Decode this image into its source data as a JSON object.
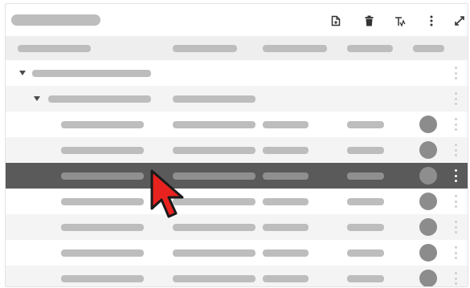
{
  "toolbar": {
    "title": "",
    "icons": [
      "add-document-icon",
      "delete-icon",
      "format-icon",
      "more-vert-icon",
      "expand-icon"
    ]
  },
  "table": {
    "columns": [
      "",
      "",
      "",
      "",
      ""
    ],
    "rows": [
      {
        "type": "group",
        "level": 0,
        "expanded": true
      },
      {
        "type": "group",
        "level": 1,
        "expanded": true
      },
      {
        "type": "item",
        "status": "circle"
      },
      {
        "type": "item",
        "status": "circle"
      },
      {
        "type": "item",
        "status": "circle",
        "selected": true
      },
      {
        "type": "item",
        "status": "circle"
      },
      {
        "type": "item",
        "status": "circle"
      },
      {
        "type": "item",
        "status": "circle"
      },
      {
        "type": "item",
        "status": "circle"
      }
    ]
  },
  "colors": {
    "placeholder": "#bdbdbd",
    "header_bg": "#eeeeee",
    "row_alt_bg": "#f4f4f4",
    "selected_bg": "#5a5a5a",
    "status_dot": "#8c8c8c",
    "cursor": "#e8231f"
  }
}
